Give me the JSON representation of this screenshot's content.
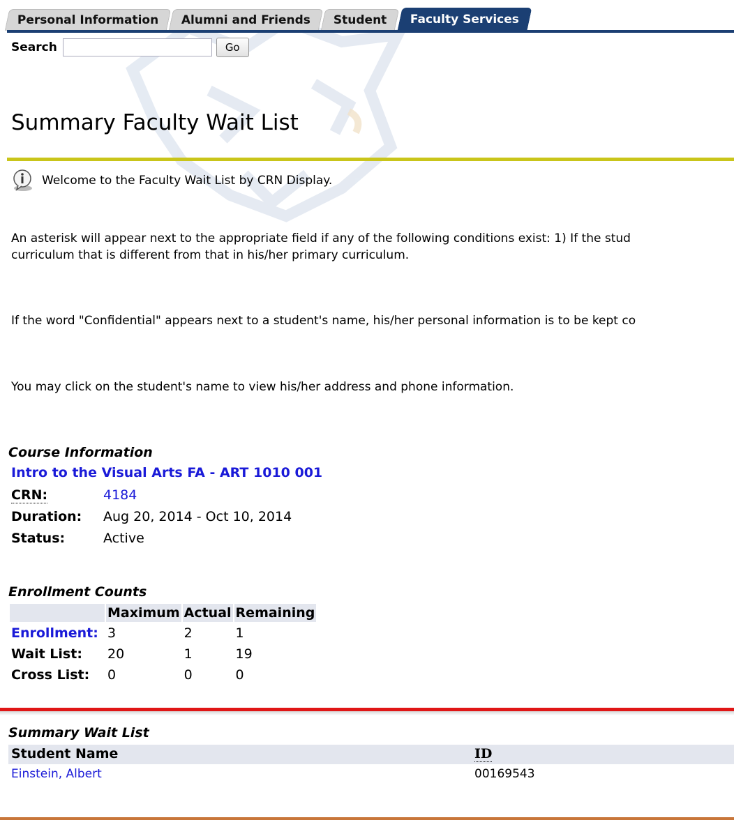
{
  "tabs": [
    {
      "label": "Personal Information"
    },
    {
      "label": "Alumni and Friends"
    },
    {
      "label": "Student"
    },
    {
      "label": "Faculty Services",
      "active": true
    }
  ],
  "search": {
    "label": "Search",
    "value": "",
    "button": "Go"
  },
  "page": {
    "title": "Summary Faculty Wait List",
    "info_message": "Welcome to the Faculty Wait List by CRN Display.",
    "paragraphs": [
      "An asterisk will appear next to the appropriate field if any of the following conditions exist: 1) If the stud",
      "curriculum that is different from that in his/her primary curriculum.",
      "If the word \"Confidential\" appears next to a student's name, his/her personal information is to be kept co",
      "You may click on the student's name to view his/her address and phone information."
    ]
  },
  "course": {
    "caption": "Course Information",
    "title_link": "Intro to the Visual Arts FA - ART 1010 001",
    "crn_label": "CRN:",
    "crn_value": "4184",
    "duration_label": "Duration:",
    "duration_value": "Aug 20, 2014 - Oct 10, 2014",
    "status_label": "Status:",
    "status_value": "Active"
  },
  "enrollment": {
    "caption": "Enrollment Counts",
    "headers": [
      "",
      "Maximum",
      "Actual",
      "Remaining"
    ],
    "rows": [
      {
        "label": "Enrollment:",
        "max": "3",
        "actual": "2",
        "remaining": "1"
      },
      {
        "label": "Wait List:",
        "max": "20",
        "actual": "1",
        "remaining": "19"
      },
      {
        "label": "Cross List:",
        "max": "0",
        "actual": "0",
        "remaining": "0"
      }
    ]
  },
  "waitlist": {
    "caption": "Summary Wait List",
    "headers": [
      "Student Name",
      "ID"
    ],
    "rows": [
      {
        "name": "Einstein, Albert",
        "id": "00169543"
      }
    ]
  },
  "colors": {
    "tab_active": "#1b3f73",
    "title_rule": "#c9c51a",
    "red_rule": "#e01616",
    "link": "#1a1ad8"
  },
  "icons": {
    "info": "info-bubble-icon",
    "watermark": "mascot-logo"
  }
}
